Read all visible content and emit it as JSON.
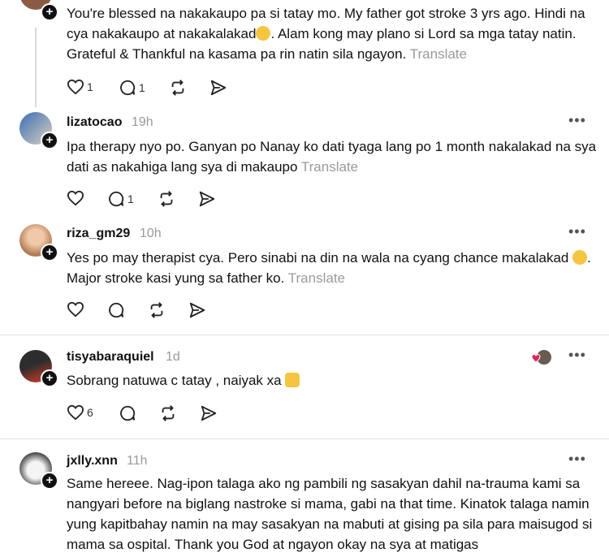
{
  "comments": [
    {
      "username": "",
      "time": "",
      "text": "You're blessed na nakakaupo pa si tatay mo. My father got stroke 3 yrs ago. Hindi na cya nakakaupo at nakakalakad",
      "text_after_emoji": ". Alam kong may plano si Lord sa mga tatay natin. Grateful & Thankful na kasama pa rin natin sila ngayon.",
      "translate": "Translate",
      "likes": "1",
      "replies": "1"
    },
    {
      "username": "lizatocao",
      "time": "19h",
      "text": "Ipa therapy nyo po. Ganyan po Nanay ko dati tyaga lang po 1 month nakalakad na sya dati as nakahiga lang sya di makaupo",
      "translate": "Translate",
      "likes": "",
      "replies": "1"
    },
    {
      "username": "riza_gm29",
      "time": "10h",
      "text": "Yes po may therapist cya. Pero sinabi na din na wala na cyang chance makalakad",
      "text_after_emoji": ". Major stroke kasi yung sa father ko.",
      "translate": "Translate",
      "likes": "",
      "replies": ""
    },
    {
      "username": "tisyabaraquiel",
      "time": "1d",
      "text": "Sobrang natuwa c tatay , naiyak xa",
      "likes": "6",
      "replies": ""
    },
    {
      "username": "jxlly.xnn",
      "time": "11h",
      "text": "Same hereee. Nag-ipon talaga ako ng pambili ng sasakyan dahil na-trauma kami sa nangyari before na biglang nastroke si mama, gabi na that time. Kinatok talaga namin yung kapitbahay namin na may sasakyan na mabuti at gising pa sila para maisugod si mama sa ospital. Thank you God at ngayon okay na sya at matigas"
    }
  ],
  "icons": {
    "like": "heart-icon",
    "reply": "speech-bubble-icon",
    "repost": "repost-icon",
    "share": "send-icon",
    "more": "more-dots-icon",
    "follow": "plus-icon"
  }
}
